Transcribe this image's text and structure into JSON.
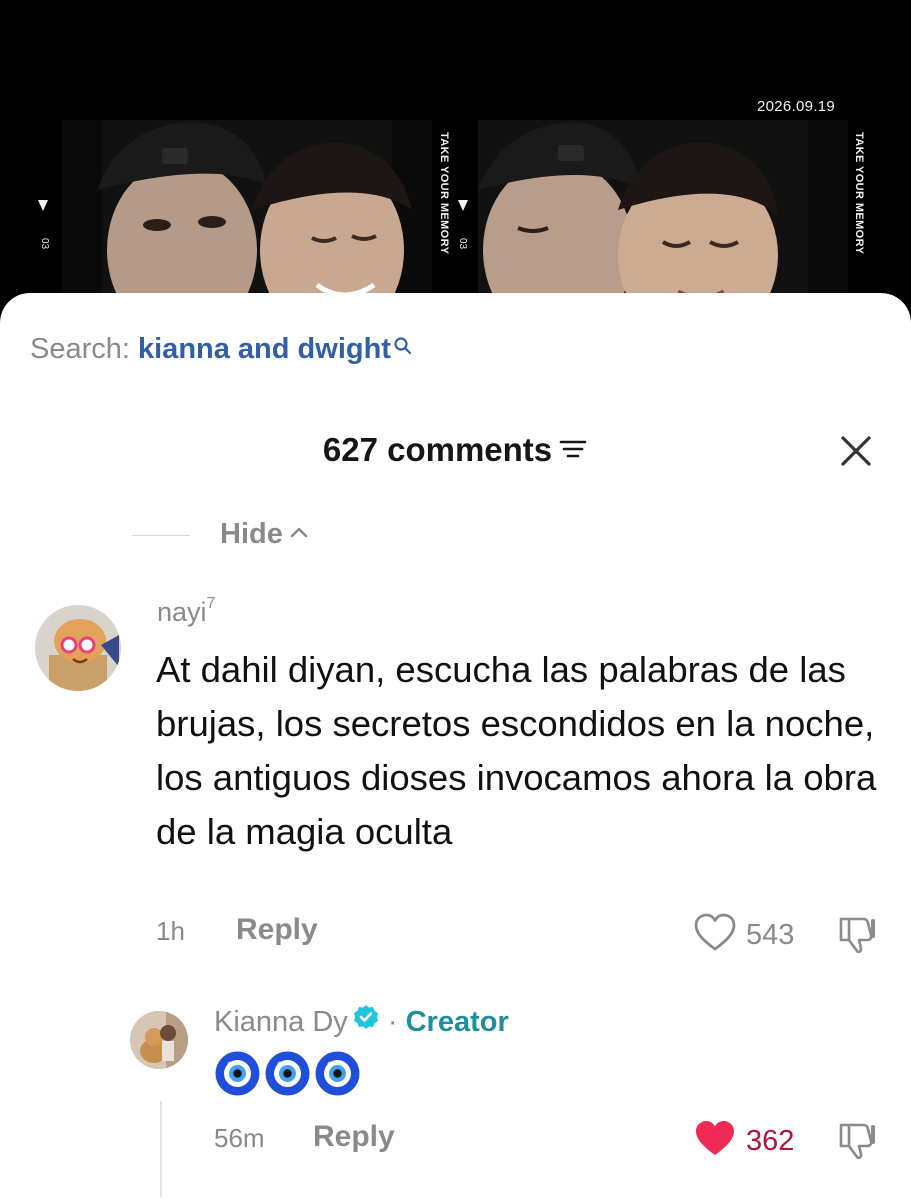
{
  "photo": {
    "date": "2026.09.19",
    "frame_number": "03",
    "frame_caption": "TAKE YOUR MEMORY"
  },
  "search": {
    "label": "Search: ",
    "query": "kianna and dwight"
  },
  "comments_header": {
    "title": "627 comments"
  },
  "thread": {
    "hide_label": "Hide"
  },
  "comments": [
    {
      "username": "nayi",
      "username_sup": "7",
      "text": "At dahil diyan, escucha las palabras de las brujas, los secretos escondidos en la noche, los antiguos dioses invocamos ahora la obra de la magia oculta",
      "time": "1h",
      "reply_label": "Reply",
      "likes": "543",
      "liked": false
    },
    {
      "username": "Kianna Dy",
      "creator_sep": " · ",
      "creator_label": "Creator",
      "text_emojis": [
        "nazar-amulet",
        "nazar-amulet",
        "nazar-amulet"
      ],
      "time": "56m",
      "reply_label": "Reply",
      "likes": "362",
      "liked": true
    }
  ],
  "colors": {
    "search_query": "#2f5fa6",
    "creator": "#1d8f9f",
    "verified": "#20c4dc",
    "liked_heart": "#ee2a55",
    "liked_count": "#b0143a",
    "muted_text": "#8a8a8a"
  }
}
